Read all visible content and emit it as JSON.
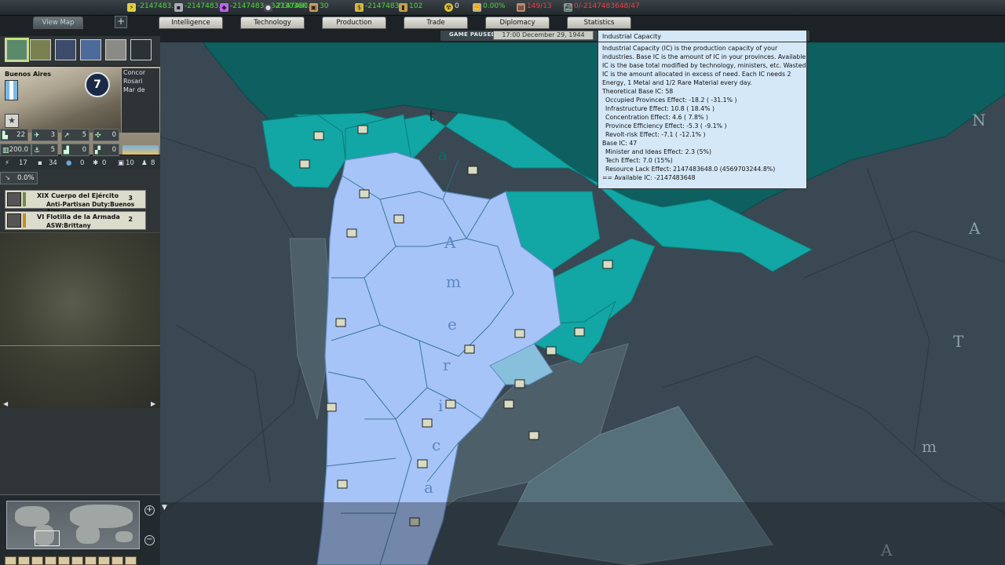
{
  "resources": [
    {
      "icon": "energy-icon",
      "value": "-2147483...",
      "cls": "green"
    },
    {
      "icon": "metal-icon",
      "value": "-2147483...",
      "cls": "green"
    },
    {
      "icon": "rare-materials-icon",
      "value": "-2147483...3273036K",
      "cls": "green"
    },
    {
      "icon": "oil-icon",
      "value": "-2147483...",
      "cls": "green"
    },
    {
      "icon": "supplies-icon",
      "value": "30",
      "cls": "green"
    },
    {
      "icon": "money-icon",
      "value": "-2147483...",
      "cls": "green"
    },
    {
      "icon": "fuel-icon",
      "value": "102",
      "cls": "green"
    },
    {
      "icon": "nuclear-icon",
      "value": "0",
      "cls": "white"
    },
    {
      "icon": "dissent-icon",
      "value": "0.00%",
      "cls": "green"
    },
    {
      "icon": "manpower-icon",
      "value": "149/13",
      "cls": "red"
    },
    {
      "icon": "convoy-icon",
      "value": "0/-2147483648/47",
      "cls": "red"
    }
  ],
  "tabs": {
    "view_map": "View Map",
    "intelligence": "Intelligence",
    "technology": "Technology",
    "production": "Production",
    "trade": "Trade",
    "diplomacy": "Diplomacy",
    "statistics": "Statistics"
  },
  "status": {
    "paused": "GAME PAUSED",
    "date": "17:00 December 29, 1944"
  },
  "province": {
    "name": "Buenos Aires",
    "victory_points": "7",
    "neighbors": [
      "Concor",
      "Rosari",
      "Mar de"
    ],
    "stats_row1": [
      "22",
      "3",
      "5",
      "0"
    ],
    "stats_row2": [
      "200.0",
      "5",
      "0",
      "0"
    ],
    "res_row": [
      "17",
      "34",
      "0",
      "0",
      "10",
      "8"
    ],
    "infra": "0.0%"
  },
  "units": [
    {
      "name": "XIX Cuerpo del Ejército",
      "task": "Anti-Partisan Duty:Buenos Aire",
      "count": "3"
    },
    {
      "name": "VI Flotilla de la Armada",
      "task": "ASW:Brittany",
      "count": "2"
    }
  ],
  "map_labels": [
    "t",
    "a",
    "A",
    "m",
    "e",
    "r",
    "i",
    "c",
    "a",
    "N",
    "A",
    "T",
    "m",
    "A"
  ],
  "tooltip": {
    "title": "Industrial Capacity",
    "lines": [
      {
        "t": "Industrial Capacity (IC) is the production capacity of your",
        "ind": false
      },
      {
        "t": "industries. Base IC is the amount of IC in your provinces. Available",
        "ind": false
      },
      {
        "t": "IC is the base total modified by technology, ministers, etc. Wasted",
        "ind": false
      },
      {
        "t": "IC is the amount allocated in excess of need. Each IC needs 2",
        "ind": false
      },
      {
        "t": "Energy, 1 Metal and 1/2 Rare Material every day.",
        "ind": false
      },
      {
        "t": "Theoretical Base IC: 58",
        "ind": false
      },
      {
        "t": "Occupied Provinces Effect: -18.2 ( -31.1% )",
        "ind": true
      },
      {
        "t": "Infrastructure Effect: 10.8 ( 18.4% )",
        "ind": true
      },
      {
        "t": "Concentration Effect: 4.6 ( 7.8% )",
        "ind": true
      },
      {
        "t": "Province Efficiency Effect: -5.3 ( -9.1% )",
        "ind": true
      },
      {
        "t": "Revolt-risk Effect: -7.1 ( -12.1% )",
        "ind": true
      },
      {
        "t": "Base IC: 47",
        "ind": false
      },
      {
        "t": "Minister and Ideas Effect: 2.3 (5%)",
        "ind": true
      },
      {
        "t": "Tech Effect: 7.0 (15%)",
        "ind": true
      },
      {
        "t": "Resource Lack Effect: 2147483648.0 (4569703244.8%)",
        "ind": true
      },
      {
        "t": "== Available IC: -2147483648",
        "ind": false
      }
    ]
  },
  "colors": {
    "own_land": "#a6c4f7",
    "teal_land": "#12a6a4",
    "dark_teal": "#0e5f5f",
    "sea": "#394852",
    "shallow_sea": "#4d5f69",
    "tooltip_bg": "#d5e8f7"
  }
}
